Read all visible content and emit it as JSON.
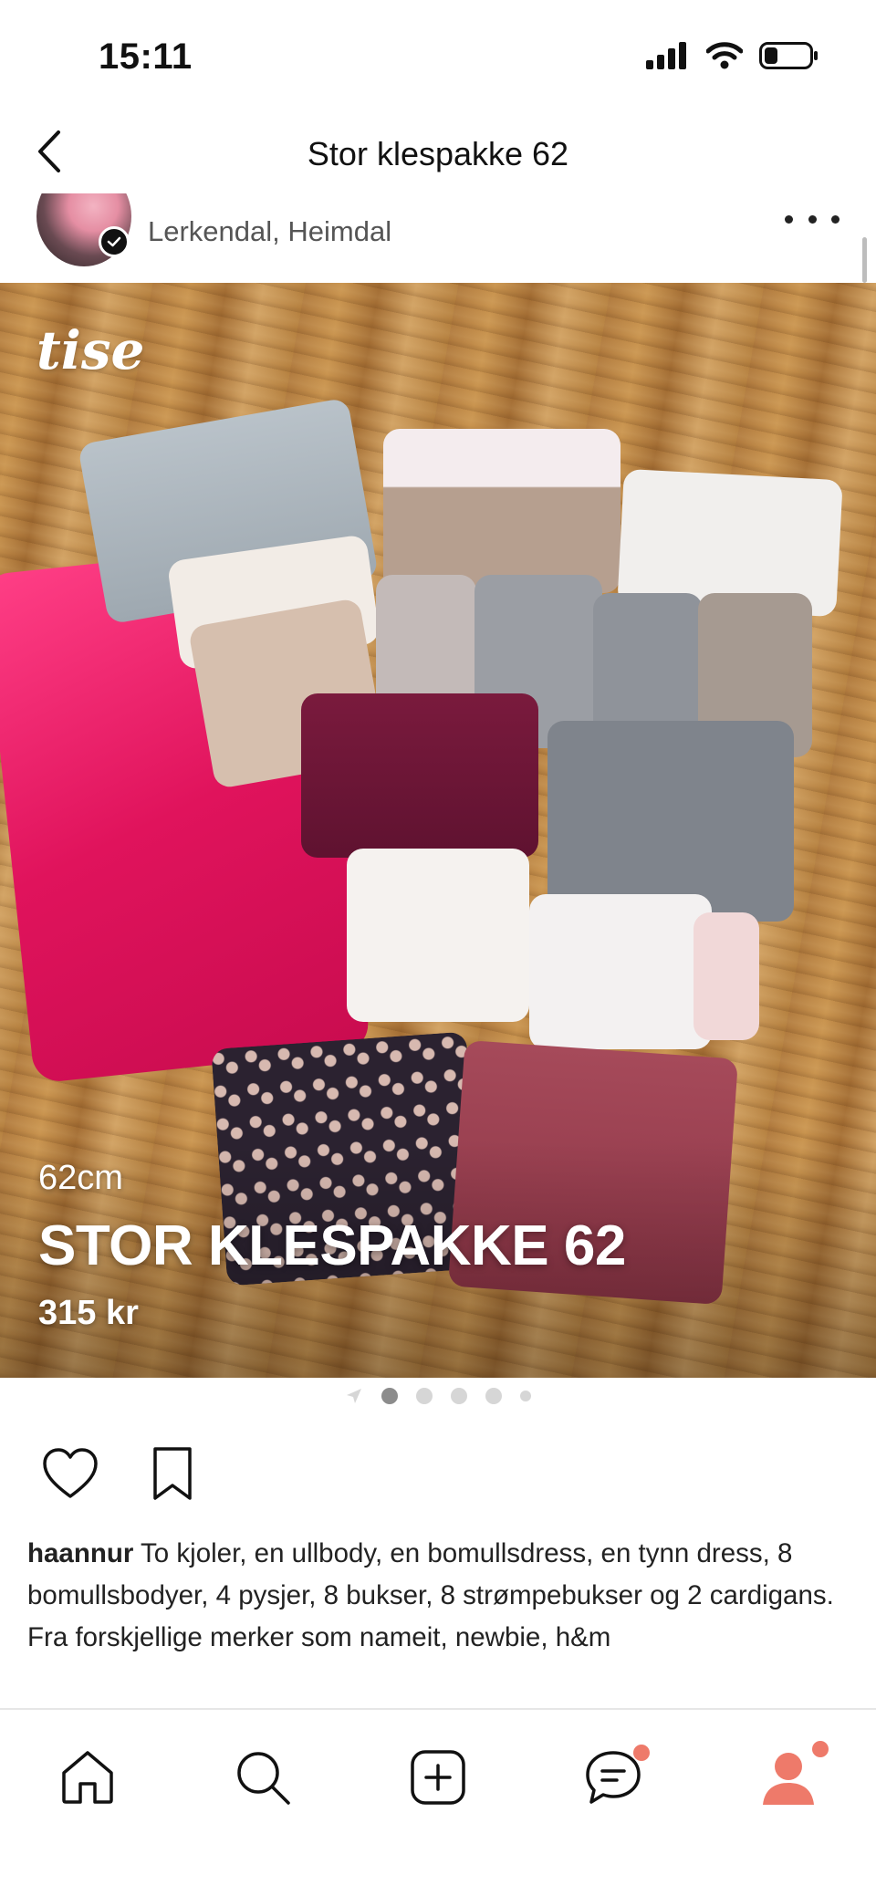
{
  "status_bar": {
    "time": "15:11"
  },
  "header": {
    "title": "Stor klespakke 62",
    "back_icon": "chevron-left-icon"
  },
  "seller": {
    "location": "Lerkendal, Heimdal",
    "verified": true
  },
  "photo": {
    "watermark": "tise",
    "size": "62cm",
    "title": "STOR KLESPAKKE 62",
    "price": "315 kr",
    "page_count": 5,
    "current_page": 1
  },
  "actions": {
    "like_icon": "heart-icon",
    "save_icon": "bookmark-icon"
  },
  "description": {
    "username": "haannur",
    "text": "To kjoler, en ullbody, en bomullsdress, en tynn dress, 8 bomullsbodyer, 4 pysjer, 8 bukser, 8 strømpebukser og 2 cardigans. Fra forskjellige merker som nameit, newbie, h&m"
  },
  "tabbar": {
    "items": [
      {
        "icon": "home-icon",
        "badge": false
      },
      {
        "icon": "search-icon",
        "badge": false
      },
      {
        "icon": "plus-icon",
        "badge": false
      },
      {
        "icon": "chat-icon",
        "badge": true
      },
      {
        "icon": "profile-icon",
        "badge": true
      }
    ],
    "accent": "#ee7a6a"
  }
}
